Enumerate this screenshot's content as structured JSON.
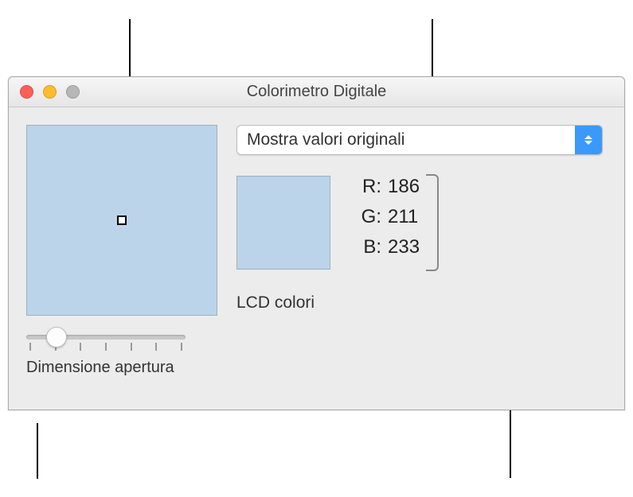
{
  "window": {
    "title": "Colorimetro Digitale"
  },
  "dropdown": {
    "selected": "Mostra valori originali"
  },
  "color": {
    "hex": "#bcd4e9",
    "r_label": "R:",
    "g_label": "G:",
    "b_label": "B:",
    "r": "186",
    "g": "211",
    "b": "233"
  },
  "display": {
    "name": "LCD colori"
  },
  "slider": {
    "label": "Dimensione apertura"
  }
}
